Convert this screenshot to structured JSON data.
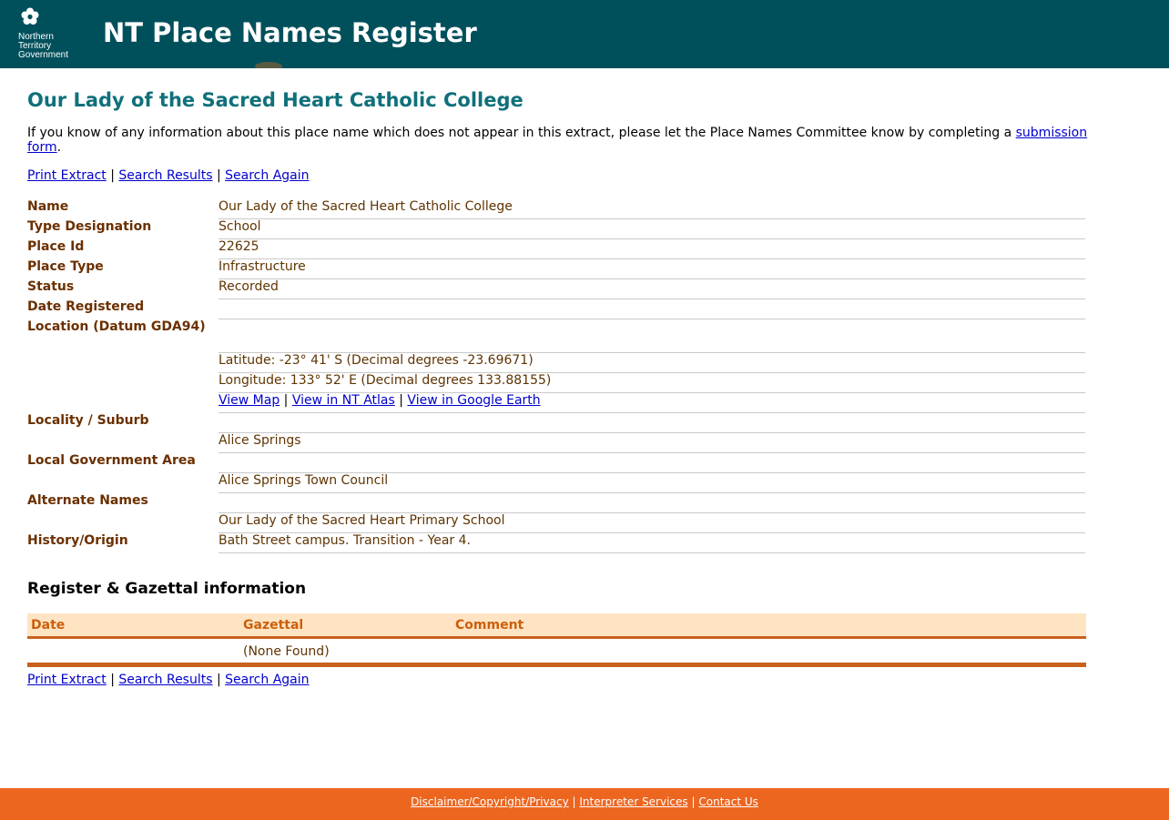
{
  "header": {
    "logo_lines": [
      "Northern",
      "Territory",
      "Government"
    ],
    "site_title": "NT Place Names Register"
  },
  "page_title": "Our Lady of the Sacred Heart Catholic College",
  "intro": {
    "text": "If you know of any information about this place name which does not appear in this extract, please let the Place Names Committee know by completing a ",
    "link": "submission form",
    "suffix": "."
  },
  "nav_links": {
    "print_extract": "Print Extract",
    "search_results": "Search Results",
    "search_again": "Search Again",
    "separator": "|"
  },
  "details": {
    "name_label": "Name",
    "name_value": "Our Lady of the Sacred Heart Catholic College",
    "type_label": "Type Designation",
    "type_value": "School",
    "place_id_label": "Place Id",
    "place_id_value": "22625",
    "place_type_label": "Place Type",
    "place_type_value": "Infrastructure",
    "status_label": "Status",
    "status_value": "Recorded",
    "date_registered_label": "Date Registered",
    "date_registered_value": "",
    "location_label": "Location (Datum GDA94)",
    "latitude": "Latitude: -23° 41' S (Decimal degrees -23.69671)",
    "longitude": "Longitude: 133° 52' E (Decimal degrees 133.88155)",
    "map_links": {
      "view_map": "View Map",
      "view_nt_atlas": "View in NT Atlas",
      "view_google_earth": "View in Google Earth"
    },
    "locality_label": "Locality / Suburb",
    "locality_value": "Alice Springs",
    "lga_label": "Local Government Area",
    "lga_value": "Alice Springs Town Council",
    "alternate_label": "Alternate Names",
    "alternate_value": "Our Lady of the Sacred Heart Primary School",
    "history_label": "History/Origin",
    "history_value": "Bath Street campus. Transition - Year 4."
  },
  "gazettal": {
    "section_title": "Register & Gazettal information",
    "columns": [
      "Date",
      "Gazettal",
      "Comment"
    ],
    "empty_message": "(None Found)"
  },
  "footer": {
    "disclaimer": "Disclaimer/Copyright/Privacy",
    "interpreter": "Interpreter Services",
    "contact": "Contact Us"
  },
  "colors": {
    "header_bg": "#00505c",
    "title_teal": "#10707a",
    "label_brown": "#6b3000",
    "footer_orange": "#ec6620",
    "table_header_bg": "#ffe4c4"
  },
  "icons": {
    "logo": "flower-logo-icon"
  }
}
